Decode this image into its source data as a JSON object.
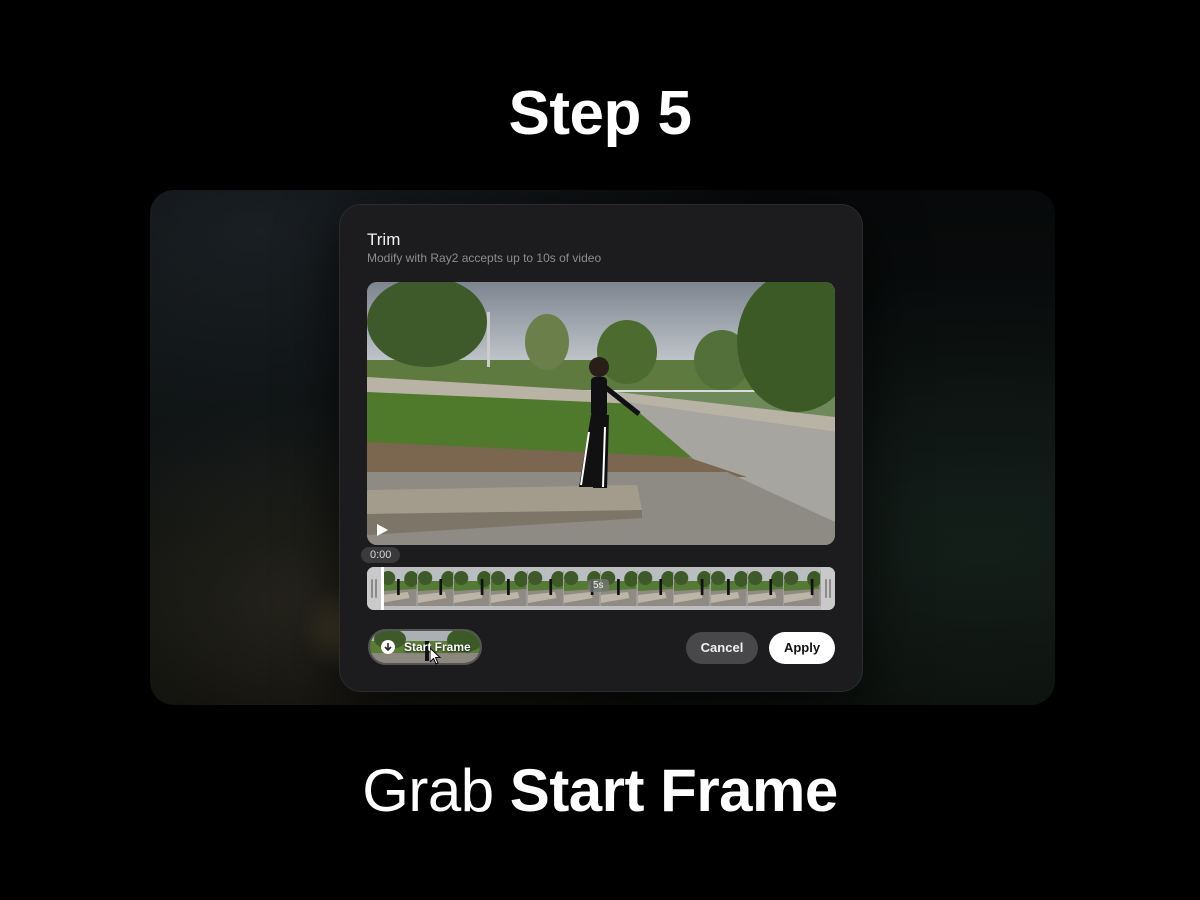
{
  "step": {
    "title": "Step 5"
  },
  "dialog": {
    "title": "Trim",
    "subtitle": "Modify with Ray2 accepts up to 10s of video",
    "video": {
      "current_time": "0:00",
      "play_icon": "play-icon"
    },
    "timeline": {
      "mid_label": "5s",
      "frame_count": 12
    },
    "start_frame_button": {
      "label": "Start Frame",
      "icon": "download-icon"
    },
    "cancel_label": "Cancel",
    "apply_label": "Apply"
  },
  "caption": {
    "regular": "Grab",
    "bold": "Start Frame"
  },
  "colors": {
    "background": "#000000",
    "dialog": "#1c1c1e",
    "cancel_button": "#48484a",
    "apply_button": "#ffffff"
  }
}
